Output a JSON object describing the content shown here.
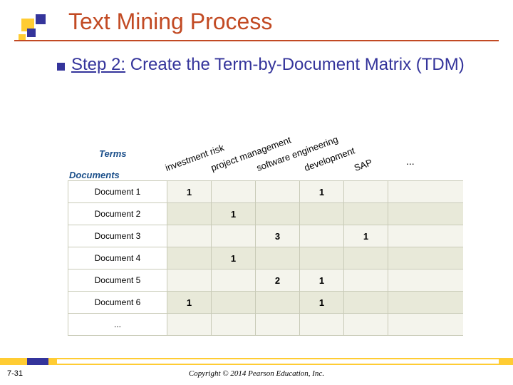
{
  "title": "Text Mining Process",
  "subtitle_prefix": "Step 2:",
  "subtitle_rest": " Create the Term-by-Document Matrix (TDM)",
  "headers": {
    "terms": "Terms",
    "documents": "Documents"
  },
  "terms": [
    "investment risk",
    "project management",
    "software engineering",
    "development",
    "SAP"
  ],
  "term_dots": "...",
  "documents": [
    "Document 1",
    "Document 2",
    "Document 3",
    "Document 4",
    "Document 5",
    "Document 6",
    "..."
  ],
  "chart_data": {
    "type": "table",
    "title": "Term-by-Document Matrix (TDM)",
    "columns": [
      "investment risk",
      "project management",
      "software engineering",
      "development",
      "SAP"
    ],
    "rows": [
      "Document 1",
      "Document 2",
      "Document 3",
      "Document 4",
      "Document 5",
      "Document 6"
    ],
    "values": [
      [
        1,
        null,
        null,
        1,
        null
      ],
      [
        null,
        1,
        null,
        null,
        null
      ],
      [
        null,
        null,
        3,
        null,
        1
      ],
      [
        null,
        1,
        null,
        null,
        null
      ],
      [
        null,
        null,
        2,
        1,
        null
      ],
      [
        1,
        null,
        null,
        1,
        null
      ]
    ]
  },
  "footer": {
    "page": "7-31",
    "copyright": "Copyright © 2014 Pearson Education, Inc."
  }
}
